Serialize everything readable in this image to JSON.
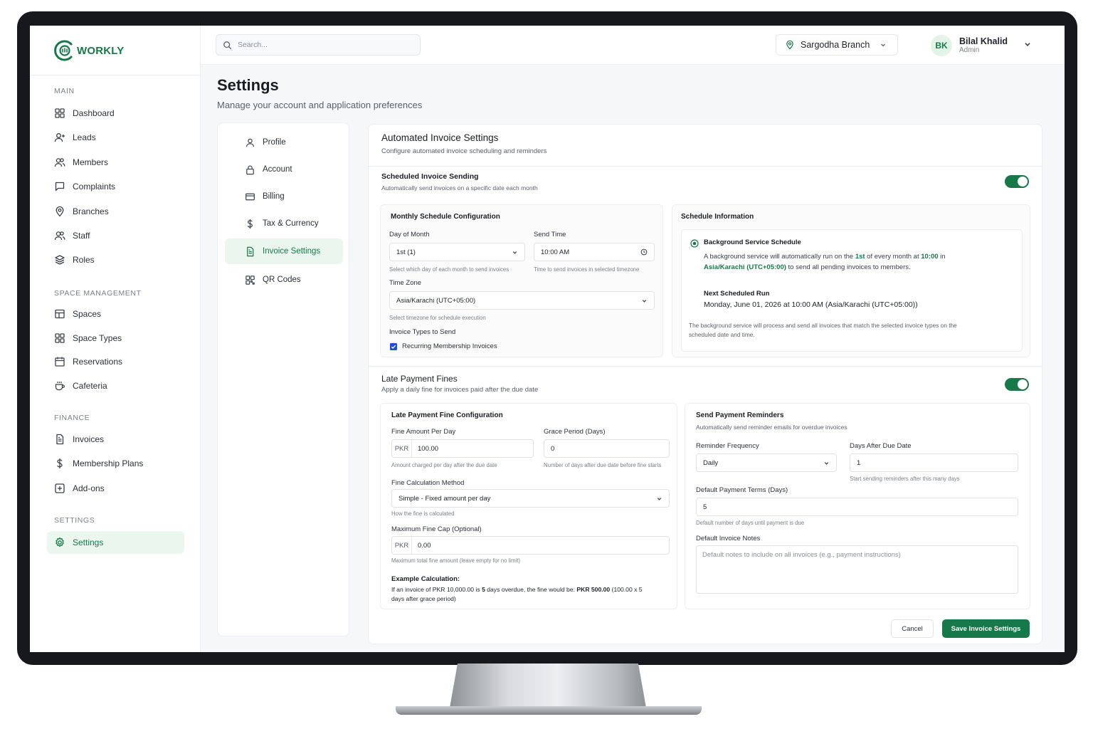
{
  "brand": {
    "name": "WORKLY",
    "accent": "#17784a",
    "accent_bg": "#eaf6ee"
  },
  "topbar": {
    "search_placeholder": "Search...",
    "branch": "Sargodha Branch",
    "user": {
      "initials": "BK",
      "name": "Bilal Khalid",
      "role": "Admin"
    }
  },
  "sidebar": {
    "sections": [
      {
        "title": "MAIN",
        "items": [
          {
            "label": "Dashboard",
            "icon": "grid-icon"
          },
          {
            "label": "Leads",
            "icon": "user-plus-icon"
          },
          {
            "label": "Members",
            "icon": "users-icon"
          },
          {
            "label": "Complaints",
            "icon": "message-square-icon"
          },
          {
            "label": "Branches",
            "icon": "map-pin-icon"
          },
          {
            "label": "Staff",
            "icon": "users-icon"
          },
          {
            "label": "Roles",
            "icon": "layers-icon"
          }
        ]
      },
      {
        "title": "SPACE MANAGEMENT",
        "items": [
          {
            "label": "Spaces",
            "icon": "table-icon"
          },
          {
            "label": "Space Types",
            "icon": "grid-icon"
          },
          {
            "label": "Reservations",
            "icon": "calendar-icon"
          },
          {
            "label": "Cafeteria",
            "icon": "coffee-icon"
          }
        ]
      },
      {
        "title": "FINANCE",
        "items": [
          {
            "label": "Invoices",
            "icon": "file-text-icon"
          },
          {
            "label": "Membership Plans",
            "icon": "dollar-icon"
          },
          {
            "label": "Add-ons",
            "icon": "plus-square-icon"
          }
        ]
      },
      {
        "title": "SETTINGS",
        "items": [
          {
            "label": "Settings",
            "icon": "gear-icon",
            "active": true
          }
        ]
      }
    ]
  },
  "page": {
    "title": "Settings",
    "subtitle": "Manage your account and application preferences"
  },
  "settings_menu": [
    {
      "label": "Profile",
      "icon": "user-icon"
    },
    {
      "label": "Account",
      "icon": "lock-icon"
    },
    {
      "label": "Billing",
      "icon": "credit-card-icon"
    },
    {
      "label": "Tax & Currency",
      "icon": "dollar-icon"
    },
    {
      "label": "Invoice Settings",
      "icon": "file-text-icon",
      "active": true
    },
    {
      "label": "QR Codes",
      "icon": "qr-code-icon"
    }
  ],
  "invoice": {
    "title": "Automated Invoice Settings",
    "subtitle": "Configure automated invoice scheduling and reminders",
    "scheduled": {
      "title": "Scheduled Invoice Sending",
      "subtitle": "Automatically send invoices on a specific date each month",
      "enabled": true
    },
    "monthly": {
      "title": "Monthly Schedule Configuration",
      "day_label": "Day of Month",
      "day_value": "1st (1)",
      "day_hint": "Select which day of each month to send invoices",
      "time_label": "Send Time",
      "time_value": "10:00 AM",
      "time_hint": "Time to send invoices in selected timezone",
      "tz_label": "Time Zone",
      "tz_value": "Asia/Karachi (UTC+05:00)",
      "tz_hint": "Select timezone for schedule execution",
      "types_label": "Invoice Types to Send",
      "types_item": "Recurring Membership Invoices",
      "types_checked": true
    },
    "schedule_info": {
      "title": "Schedule Information",
      "bg_title": "Background Service Schedule",
      "bg_p1": "A background service will automatically run on the ",
      "bg_day": "1st",
      "bg_p2": " of every month at ",
      "bg_time": "10:00",
      "bg_p3": " in",
      "bg_tz": "Asia/Karachi (UTC+05:00)",
      "bg_p4": " to send all pending invoices to members.",
      "next_title": "Next Scheduled Run",
      "next_value": "Monday, June 01, 2026 at 10:00 AM (Asia/Karachi (UTC+05:00))",
      "note_l1": "The background service will process and send all invoices that match the selected invoice types on the",
      "note_l2": "scheduled date and time."
    },
    "late": {
      "title": "Late Payment Fines",
      "subtitle": "Apply a daily fine for invoices paid after the due date",
      "enabled": true
    },
    "fine_config": {
      "title": "Late Payment Fine Configuration",
      "amount_label": "Fine Amount Per Day",
      "currency": "PKR",
      "amount_value": "100.00",
      "amount_hint": "Amount charged per day after the due date",
      "grace_label": "Grace Period (Days)",
      "grace_value": "0",
      "grace_hint": "Number of days after due date before fine starts",
      "method_label": "Fine Calculation Method",
      "method_value": "Simple - Fixed amount per day",
      "method_hint": "How the fine is calculated",
      "cap_label": "Maximum Fine Cap (Optional)",
      "cap_value": "0.00",
      "cap_hint": "Maximum total fine amount (leave empty for no limit)",
      "example_title": "Example Calculation:",
      "example_p1": "If an invoice of PKR 10,000.00 is ",
      "example_days": "5",
      "example_p2": " days overdue, the fine would be: ",
      "example_total": "PKR 500.00",
      "example_p3": " (100.00 x 5",
      "example_l2": "days after grace period)"
    },
    "reminders": {
      "title": "Send Payment Reminders",
      "subtitle": "Automatically send reminder emails for overdue invoices",
      "freq_label": "Reminder Frequency",
      "freq_value": "Daily",
      "after_label": "Days After Due Date",
      "after_value": "1",
      "after_hint": "Start sending reminders after this many days",
      "terms_label": "Default Payment Terms (Days)",
      "terms_value": "5",
      "terms_hint": "Default number of days until payment is due",
      "notes_label": "Default Invoice Notes",
      "notes_placeholder": "Default notes to include on all invoices (e.g., payment instructions)"
    },
    "actions": {
      "cancel": "Cancel",
      "save": "Save Invoice Settings"
    }
  }
}
